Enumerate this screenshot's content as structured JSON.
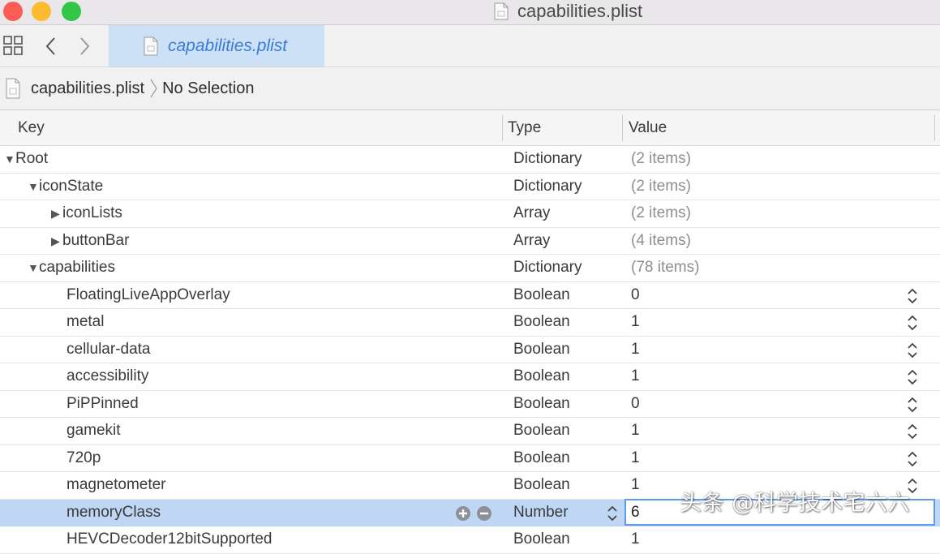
{
  "window": {
    "title": "capabilities.plist"
  },
  "tab": {
    "label": "capabilities.plist"
  },
  "breadcrumb": {
    "file": "capabilities.plist",
    "selection": "No Selection"
  },
  "table": {
    "headers": {
      "key": "Key",
      "type": "Type",
      "value": "Value"
    },
    "rows": [
      {
        "key": "Root",
        "type": "Dictionary",
        "value": "(2 items)"
      },
      {
        "key": "iconState",
        "type": "Dictionary",
        "value": "(2 items)"
      },
      {
        "key": "iconLists",
        "type": "Array",
        "value": "(2 items)"
      },
      {
        "key": "buttonBar",
        "type": "Array",
        "value": "(4 items)"
      },
      {
        "key": "capabilities",
        "type": "Dictionary",
        "value": "(78 items)"
      },
      {
        "key": "FloatingLiveAppOverlay",
        "type": "Boolean",
        "value": "0"
      },
      {
        "key": "metal",
        "type": "Boolean",
        "value": "1"
      },
      {
        "key": "cellular-data",
        "type": "Boolean",
        "value": "1"
      },
      {
        "key": "accessibility",
        "type": "Boolean",
        "value": "1"
      },
      {
        "key": "PiPPinned",
        "type": "Boolean",
        "value": "0"
      },
      {
        "key": "gamekit",
        "type": "Boolean",
        "value": "1"
      },
      {
        "key": "720p",
        "type": "Boolean",
        "value": "1"
      },
      {
        "key": "magnetometer",
        "type": "Boolean",
        "value": "1"
      },
      {
        "key": "memoryClass",
        "type": "Number",
        "value": "6"
      },
      {
        "key": "HEVCDecoder12bitSupported",
        "type": "Boolean",
        "value": "1"
      }
    ]
  },
  "watermark": "头条 @科学技术宅六六",
  "colors": {
    "selection": "#bfd7f5",
    "accent": "#3b7ad7",
    "focus_ring": "#5e9ceb"
  }
}
